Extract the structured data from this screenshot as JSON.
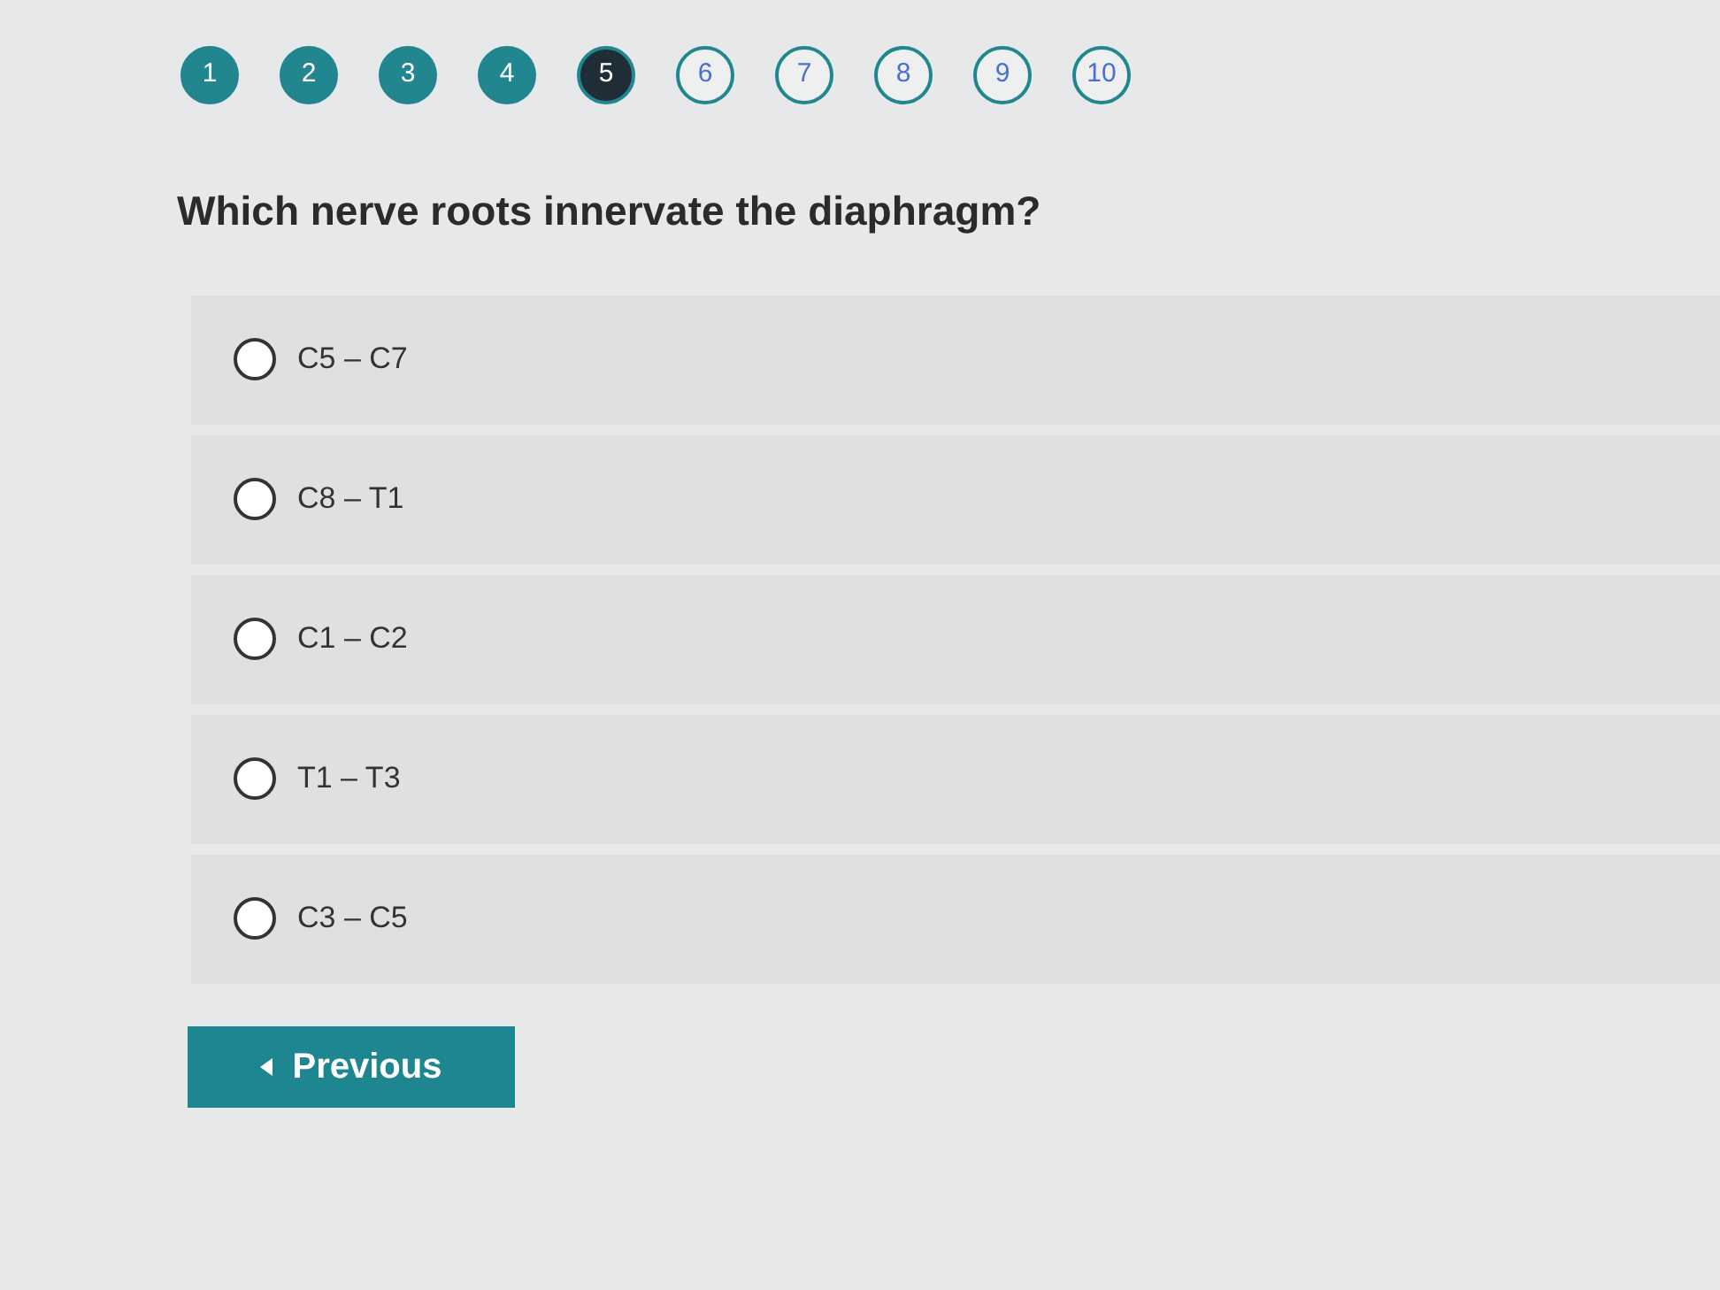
{
  "steps": [
    {
      "label": "1",
      "answered": true,
      "selected": false
    },
    {
      "label": "2",
      "answered": true,
      "selected": false
    },
    {
      "label": "3",
      "answered": true,
      "selected": false
    },
    {
      "label": "4",
      "answered": true,
      "selected": false
    },
    {
      "label": "5",
      "answered": false,
      "selected": true
    },
    {
      "label": "6",
      "answered": false,
      "selected": false
    },
    {
      "label": "7",
      "answered": false,
      "selected": false
    },
    {
      "label": "8",
      "answered": false,
      "selected": false
    },
    {
      "label": "9",
      "answered": false,
      "selected": false
    },
    {
      "label": "10",
      "answered": false,
      "selected": false
    }
  ],
  "question": "Which nerve roots innervate the diaphragm?",
  "options": [
    {
      "label": "C5 – C7",
      "selected": false
    },
    {
      "label": "C8 – T1",
      "selected": false
    },
    {
      "label": "C1 – C2",
      "selected": false
    },
    {
      "label": "T1 – T3",
      "selected": false
    },
    {
      "label": "C3 – C5",
      "selected": false
    }
  ],
  "previous_button": {
    "label": "Previous"
  }
}
